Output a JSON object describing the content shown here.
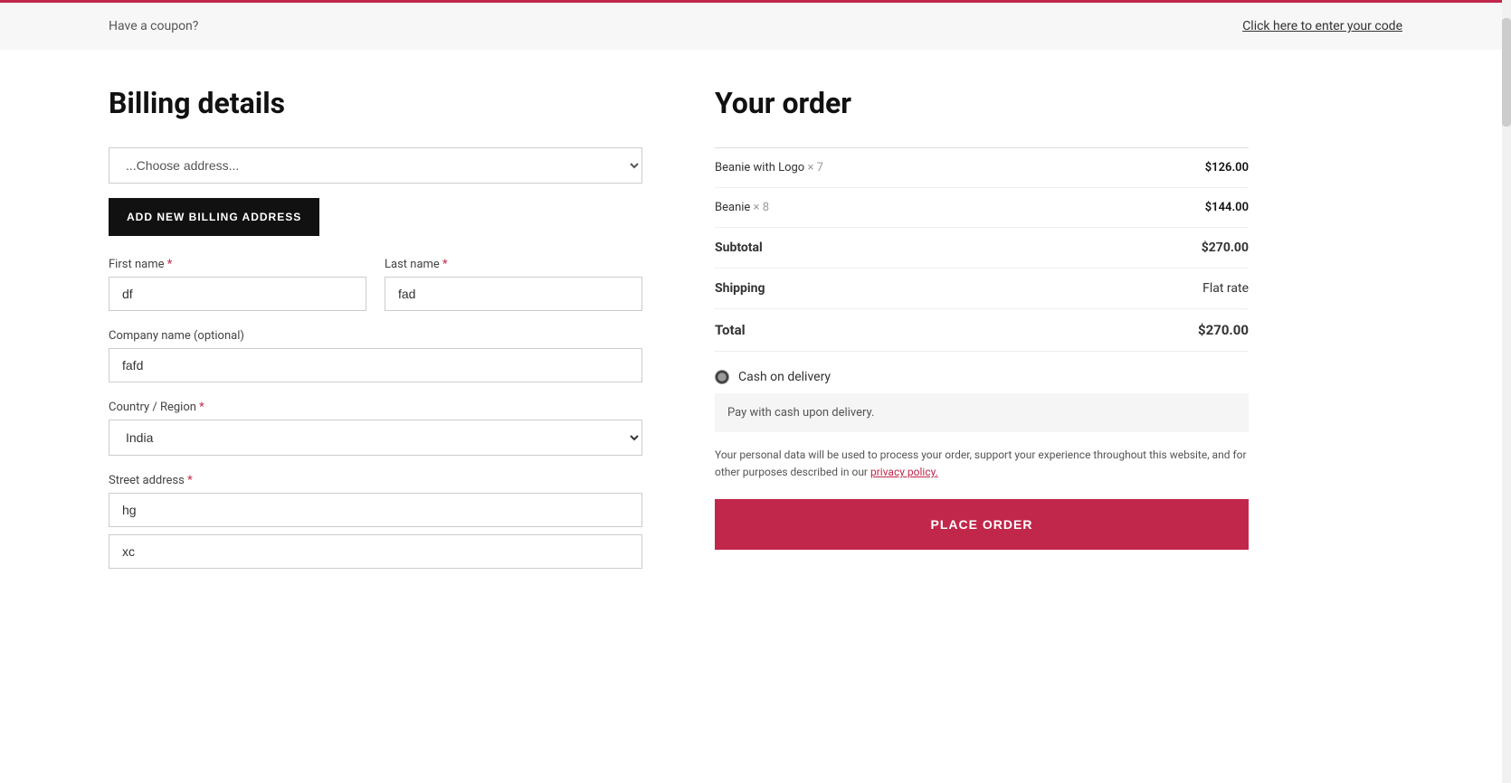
{
  "coupon_bar": {
    "prompt_text": "Have a coupon?",
    "link_text": "Click here to enter your code"
  },
  "billing": {
    "title": "Billing details",
    "address_select": {
      "placeholder": "...Choose address..."
    },
    "add_address_button": "ADD NEW BILLING ADDRESS",
    "first_name": {
      "label": "First name",
      "required": true,
      "value": "df"
    },
    "last_name": {
      "label": "Last name",
      "required": true,
      "value": "fad"
    },
    "company_name": {
      "label": "Company name (optional)",
      "required": false,
      "value": "fafd"
    },
    "country": {
      "label": "Country / Region",
      "required": true,
      "value": "India"
    },
    "street_address": {
      "label": "Street address",
      "required": true,
      "value": "hg"
    },
    "street_address2": {
      "value": "xc"
    }
  },
  "order": {
    "title": "Your order",
    "items": [
      {
        "name": "Beanie with Logo",
        "quantity": "× 7",
        "price": "$126.00"
      },
      {
        "name": "Beanie",
        "quantity": "× 8",
        "price": "$144.00"
      }
    ],
    "subtotal_label": "Subtotal",
    "subtotal_value": "$270.00",
    "shipping_label": "Shipping",
    "shipping_value": "Flat rate",
    "total_label": "Total",
    "total_value": "$270.00",
    "payment": {
      "option_label": "Cash on delivery",
      "description": "Pay with cash upon delivery."
    },
    "privacy_text_before": "Your personal data will be used to process your order, support your experience throughout this website, and for other purposes described in our ",
    "privacy_link_text": "privacy policy.",
    "privacy_text_after": "",
    "place_order_button": "PLACE ORDER"
  }
}
